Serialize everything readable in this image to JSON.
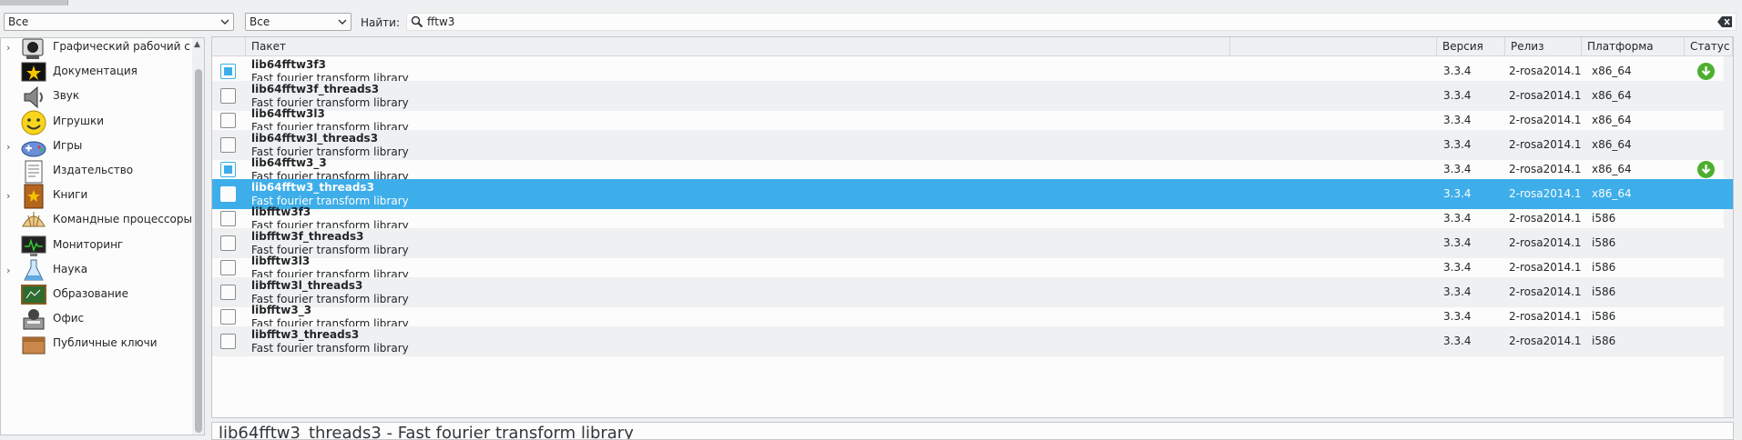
{
  "filters": {
    "group_value": "Все",
    "status_value": "Все",
    "find_label": "Найти:",
    "search_value": "fftw3"
  },
  "categories": [
    {
      "label": "Графический рабочий с",
      "expandable": true,
      "icon": "graphics-workstation-icon"
    },
    {
      "label": "Документация",
      "expandable": false,
      "icon": "documentation-icon"
    },
    {
      "label": "Звук",
      "expandable": false,
      "icon": "speaker-icon"
    },
    {
      "label": "Игрушки",
      "expandable": false,
      "icon": "smiley-icon"
    },
    {
      "label": "Игры",
      "expandable": true,
      "icon": "gamepad-icon"
    },
    {
      "label": "Издательство",
      "expandable": false,
      "icon": "publishing-icon"
    },
    {
      "label": "Книги",
      "expandable": true,
      "icon": "book-icon"
    },
    {
      "label": "Командные процессоры",
      "expandable": false,
      "icon": "shell-icon"
    },
    {
      "label": "Мониторинг",
      "expandable": false,
      "icon": "monitor-icon"
    },
    {
      "label": "Наука",
      "expandable": true,
      "icon": "flask-icon"
    },
    {
      "label": "Образование",
      "expandable": false,
      "icon": "chalkboard-icon"
    },
    {
      "label": "Офис",
      "expandable": false,
      "icon": "office-icon"
    },
    {
      "label": "Публичные ключи",
      "expandable": false,
      "icon": "keys-icon"
    }
  ],
  "columns": {
    "package": "Пакет",
    "version": "Версия",
    "release": "Релиз",
    "platform": "Платформа",
    "status": "Статус"
  },
  "packages": [
    {
      "name": "lib64fftw3f3",
      "description": "Fast fourier transform library",
      "version": "3.3.4",
      "release": "2-rosa2014.1",
      "platform": "x86_64",
      "checked": true,
      "status": "download-icon"
    },
    {
      "name": "lib64fftw3f_threads3",
      "description": "Fast fourier transform library",
      "version": "3.3.4",
      "release": "2-rosa2014.1",
      "platform": "x86_64",
      "checked": false,
      "status": ""
    },
    {
      "name": "lib64fftw3l3",
      "description": "Fast fourier transform library",
      "version": "3.3.4",
      "release": "2-rosa2014.1",
      "platform": "x86_64",
      "checked": false,
      "status": ""
    },
    {
      "name": "lib64fftw3l_threads3",
      "description": "Fast fourier transform library",
      "version": "3.3.4",
      "release": "2-rosa2014.1",
      "platform": "x86_64",
      "checked": false,
      "status": ""
    },
    {
      "name": "lib64fftw3_3",
      "description": "Fast fourier transform library",
      "version": "3.3.4",
      "release": "2-rosa2014.1",
      "platform": "x86_64",
      "checked": true,
      "status": "download-icon"
    },
    {
      "name": "lib64fftw3_threads3",
      "description": "Fast fourier transform library",
      "version": "3.3.4",
      "release": "2-rosa2014.1",
      "platform": "x86_64",
      "checked": false,
      "status": "",
      "selected": true
    },
    {
      "name": "libfftw3f3",
      "description": "Fast fourier transform library",
      "version": "3.3.4",
      "release": "2-rosa2014.1",
      "platform": "i586",
      "checked": false,
      "status": ""
    },
    {
      "name": "libfftw3f_threads3",
      "description": "Fast fourier transform library",
      "version": "3.3.4",
      "release": "2-rosa2014.1",
      "platform": "i586",
      "checked": false,
      "status": ""
    },
    {
      "name": "libfftw3l3",
      "description": "Fast fourier transform library",
      "version": "3.3.4",
      "release": "2-rosa2014.1",
      "platform": "i586",
      "checked": false,
      "status": ""
    },
    {
      "name": "libfftw3l_threads3",
      "description": "Fast fourier transform library",
      "version": "3.3.4",
      "release": "2-rosa2014.1",
      "platform": "i586",
      "checked": false,
      "status": ""
    },
    {
      "name": "libfftw3_3",
      "description": "Fast fourier transform library",
      "version": "3.3.4",
      "release": "2-rosa2014.1",
      "platform": "i586",
      "checked": false,
      "status": ""
    },
    {
      "name": "libfftw3_threads3",
      "description": "Fast fourier transform library",
      "version": "3.3.4",
      "release": "2-rosa2014.1",
      "platform": "i586",
      "checked": false,
      "status": ""
    }
  ],
  "info": {
    "text": "lib64fftw3_threads3 - Fast fourier transform library"
  },
  "colors": {
    "selection": "#3daee9",
    "status_ok": "#4caf2e"
  }
}
